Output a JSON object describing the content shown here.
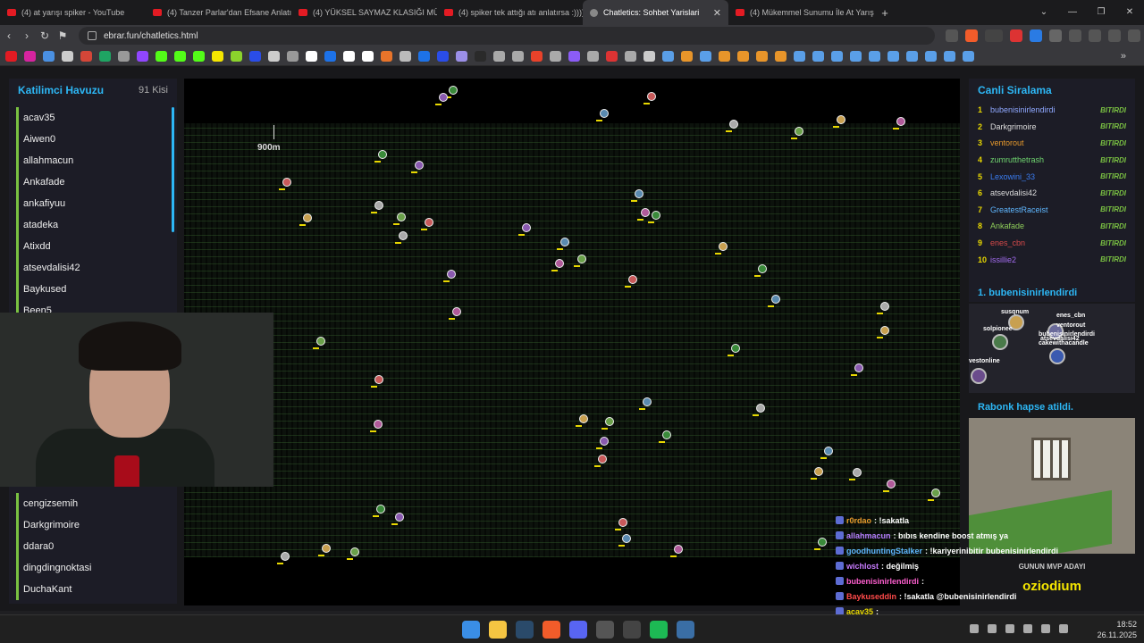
{
  "browser": {
    "tabs": [
      {
        "title": "(4) at yarışı spiker - YouTube",
        "active": false
      },
      {
        "title": "(4) Tanzer Parlar'dan Efsane Anlatım",
        "active": false
      },
      {
        "title": "(4) YÜKSEL SAYMAZ KLASIĞI MÜKEMMEL",
        "active": false
      },
      {
        "title": "(4) spiker tek attığı atı anlatırsa :))))))",
        "active": false
      },
      {
        "title": "Chatletics: Sohbet Yarislari",
        "active": true
      },
      {
        "title": "(4) Mükemmel Sunumu İle At Yarışı",
        "active": false
      }
    ],
    "url": "ebrar.fun/chatletics.html"
  },
  "left_panel": {
    "title": "Katilimci Havuzu",
    "count": "91 Kisi",
    "participants_top": [
      "acav35",
      "Aiwen0",
      "allahmacun",
      "Ankafade",
      "ankafiyuu",
      "atadeka",
      "Atixdd",
      "atsevdalisi42",
      "Baykused",
      "Been5"
    ],
    "participants_bottom": [
      "cengizsemih",
      "Darkgrimoire",
      "ddara0",
      "dingdingnoktasi",
      "DuchaKant"
    ]
  },
  "race": {
    "distance_marker": "900m",
    "accent_bar": "#e8d800"
  },
  "ranking": {
    "title": "Canli Siralama",
    "rows": [
      {
        "rank": "1",
        "name": "bubenisinirlendirdi",
        "status": "BITIRDI",
        "color": "#8fa8ff"
      },
      {
        "rank": "2",
        "name": "Darkgrimoire",
        "status": "BITIRDI",
        "color": "#dddddd"
      },
      {
        "rank": "3",
        "name": "ventorout",
        "status": "BITIRDI",
        "color": "#e89a2c"
      },
      {
        "rank": "4",
        "name": "zumrutthetrash",
        "status": "BITIRDI",
        "color": "#6fd46f"
      },
      {
        "rank": "5",
        "name": "Lexowini_33",
        "status": "BITIRDI",
        "color": "#3a7cf0"
      },
      {
        "rank": "6",
        "name": "atsevdalisi42",
        "status": "BITIRDI",
        "color": "#dddddd"
      },
      {
        "rank": "7",
        "name": "GreatestRaceist",
        "status": "BITIRDI",
        "color": "#5fb7ff"
      },
      {
        "rank": "8",
        "name": "Ankafade",
        "status": "BITIRDI",
        "color": "#8fce5a"
      },
      {
        "rank": "9",
        "name": "enes_cbn",
        "status": "BITIRDI",
        "color": "#d84a4a"
      },
      {
        "rank": "10",
        "name": "issillie2",
        "status": "BITIRDI",
        "color": "#a36cf0"
      }
    ]
  },
  "leader": {
    "title": "1. bubenisinirlendirdi",
    "labels": [
      "susqnum",
      "enes_cbn",
      "solpionee",
      "ventorout",
      "bubenisinirlendirdi",
      "atsevdalisi42",
      "cakewithacandle",
      "vestonline"
    ]
  },
  "jail": {
    "title": "Rabonk hapse atildi."
  },
  "mvp": {
    "label": "GUNUN MVP ADAYI",
    "name": "oziodium"
  },
  "chat": [
    {
      "user": "r0rdao",
      "message": ": !sakatla",
      "color": "#e89a2c"
    },
    {
      "user": "allahmacun",
      "message": ": bıbıs kendine boost atmış ya",
      "color": "#b57cff"
    },
    {
      "user": "goodhuntingStalker",
      "message": ": !kariyerinibitir bubenisinirlendirdi",
      "color": "#5fb7ff"
    },
    {
      "user": "wichlost",
      "message": ": değilmiş",
      "color": "#c87cff"
    },
    {
      "user": "bubenisinirlendirdi",
      "message": ":",
      "color": "#ff5fd0"
    },
    {
      "user": "Baykuseddin",
      "message": ": !sakatla @bubenisinirlendirdi",
      "color": "#ff4a4a"
    },
    {
      "user": "acav35",
      "message": ":",
      "color": "#e8d800"
    }
  ],
  "taskbar": {
    "time": "18:52",
    "date": "26.11.2025"
  }
}
